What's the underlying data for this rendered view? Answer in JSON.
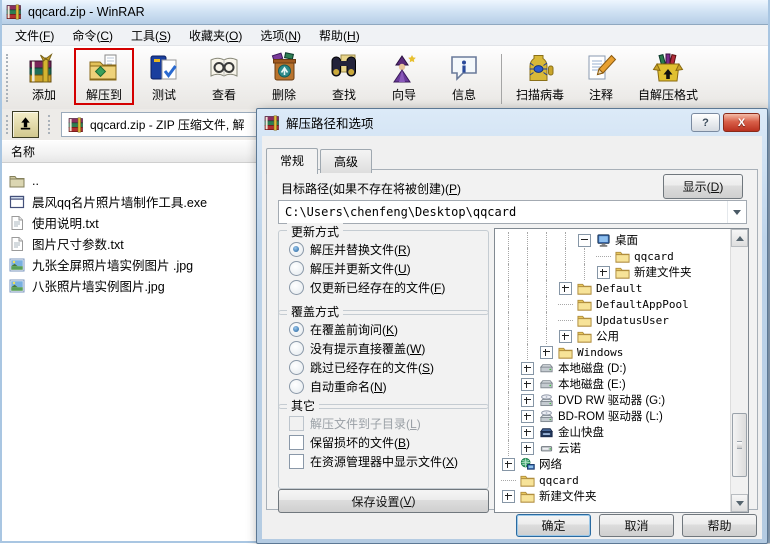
{
  "window": {
    "title": "qqcard.zip - WinRAR"
  },
  "menubar": {
    "items": [
      "文件(F)",
      "命令(C)",
      "工具(S)",
      "收藏夹(O)",
      "选项(N)",
      "帮助(H)"
    ]
  },
  "toolbar": {
    "buttons": [
      {
        "label": "添加",
        "icon": "add-archive-icon"
      },
      {
        "label": "解压到",
        "icon": "extract-to-icon",
        "highlighted": true
      },
      {
        "label": "测试",
        "icon": "test-archive-icon"
      },
      {
        "label": "查看",
        "icon": "view-file-icon"
      },
      {
        "label": "删除",
        "icon": "delete-icon"
      },
      {
        "label": "查找",
        "icon": "find-icon"
      },
      {
        "label": "向导",
        "icon": "wizard-icon"
      },
      {
        "label": "信息",
        "icon": "info-icon"
      },
      {
        "label": "扫描病毒",
        "icon": "virus-scan-icon",
        "separator_before": true
      },
      {
        "label": "注释",
        "icon": "comment-icon"
      },
      {
        "label": "自解压格式",
        "icon": "sfx-icon"
      }
    ]
  },
  "addressbar": {
    "archive_label": "qqcard.zip - ZIP 压缩文件, 解"
  },
  "filelist": {
    "header": "名称",
    "items": [
      {
        "name": "..",
        "icon": "folder-up-icon"
      },
      {
        "name": "晨风qq名片照片墙制作工具.exe",
        "icon": "exe-file-icon"
      },
      {
        "name": "使用说明.txt",
        "icon": "txt-file-icon"
      },
      {
        "name": "图片尺寸参数.txt",
        "icon": "txt-file-icon"
      },
      {
        "name": "九张全屏照片墙实例图片 .jpg",
        "icon": "jpg-file-icon"
      },
      {
        "name": "八张照片墙实例图片.jpg",
        "icon": "jpg-file-icon"
      }
    ]
  },
  "dialog": {
    "title": "解压路径和选项",
    "help_glyph": "?",
    "close_glyph": "X",
    "tabs": [
      {
        "label": "常规",
        "active": true
      },
      {
        "label": "高级",
        "active": false
      }
    ],
    "path_label": "目标路径(如果不存在将被创建)(P)",
    "display_button": "显示(D)",
    "path_value": "C:\\Users\\chenfeng\\Desktop\\qqcard",
    "update_group": {
      "title": "更新方式",
      "type": "radio",
      "options": [
        {
          "label": "解压并替换文件(R)",
          "checked": true
        },
        {
          "label": "解压并更新文件(U)",
          "checked": false
        },
        {
          "label": "仅更新已经存在的文件(F)",
          "checked": false
        }
      ]
    },
    "overwrite_group": {
      "title": "覆盖方式",
      "type": "radio",
      "options": [
        {
          "label": "在覆盖前询问(K)",
          "checked": true
        },
        {
          "label": "没有提示直接覆盖(W)",
          "checked": false
        },
        {
          "label": "跳过已经存在的文件(S)",
          "checked": false
        },
        {
          "label": "自动重命名(N)",
          "checked": false
        }
      ]
    },
    "other_group": {
      "title": "其它",
      "type": "checkbox",
      "options": [
        {
          "label": "解压文件到子目录(L)",
          "checked": false,
          "disabled": true
        },
        {
          "label": "保留损坏的文件(B)",
          "checked": false
        },
        {
          "label": "在资源管理器中显示文件(X)",
          "checked": false
        }
      ]
    },
    "save_button": "保存设置(V)",
    "tree": {
      "items": [
        {
          "label": "桌面",
          "level": 4,
          "expander": "minus",
          "icon": "desktop-icon"
        },
        {
          "label": "qqcard",
          "level": 5,
          "expander": "none",
          "icon": "folder-icon",
          "mono": true
        },
        {
          "label": "新建文件夹",
          "level": 5,
          "expander": "plus",
          "icon": "folder-icon"
        },
        {
          "label": "Default",
          "level": 3,
          "expander": "plus",
          "icon": "folder-icon",
          "mono": true
        },
        {
          "label": "DefaultAppPool",
          "level": 3,
          "expander": "none",
          "icon": "folder-icon",
          "mono": true
        },
        {
          "label": "UpdatusUser",
          "level": 3,
          "expander": "none",
          "icon": "folder-icon",
          "mono": true
        },
        {
          "label": "公用",
          "level": 3,
          "expander": "plus",
          "icon": "folder-icon"
        },
        {
          "label": "Windows",
          "level": 2,
          "expander": "plus",
          "icon": "folder-icon",
          "mono": true
        },
        {
          "label": "本地磁盘 (D:)",
          "level": 1,
          "expander": "plus",
          "icon": "drive-icon"
        },
        {
          "label": "本地磁盘 (E:)",
          "level": 1,
          "expander": "plus",
          "icon": "drive-icon"
        },
        {
          "label": "DVD RW 驱动器 (G:)",
          "level": 1,
          "expander": "plus",
          "icon": "cd-drive-icon"
        },
        {
          "label": "BD-ROM 驱动器 (L:)",
          "level": 1,
          "expander": "plus",
          "icon": "cd-drive-icon"
        },
        {
          "label": "金山快盘",
          "level": 1,
          "expander": "plus",
          "icon": "dark-drive-icon"
        },
        {
          "label": "云诺",
          "level": 1,
          "expander": "plus",
          "icon": "mini-drive-icon"
        },
        {
          "label": "网络",
          "level": 0,
          "expander": "plus",
          "icon": "network-icon"
        },
        {
          "label": "qqcard",
          "level": 0,
          "expander": "none",
          "icon": "folder-icon",
          "mono": true
        },
        {
          "label": "新建文件夹",
          "level": 0,
          "expander": "plus",
          "icon": "folder-icon"
        }
      ]
    },
    "buttons": {
      "ok": "确定",
      "cancel": "取消",
      "help": "帮助"
    }
  }
}
